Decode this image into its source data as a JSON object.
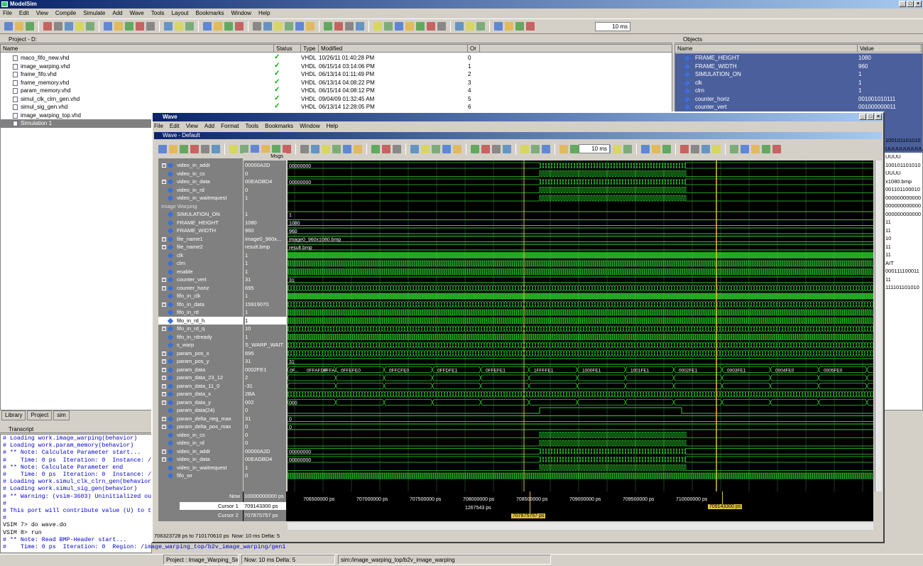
{
  "app": {
    "title": "ModelSim"
  },
  "menu": [
    "File",
    "Edit",
    "View",
    "Compile",
    "Simulate",
    "Add",
    "Wave",
    "Tools",
    "Layout",
    "Bookmarks",
    "Window",
    "Help"
  ],
  "toolbar": {
    "zoom_value": "10 ms"
  },
  "project": {
    "header": "Project - D:",
    "columns": [
      "Name",
      "Status",
      "Type",
      "Modified",
      "Order"
    ],
    "files": [
      {
        "name": "maco_fifo_new.vhd",
        "type": "VHDL",
        "modified": "10/26/11 01:40:28 PM",
        "order": "0"
      },
      {
        "name": "image_warping.vhd",
        "type": "VHDL",
        "modified": "06/15/14 03:14:06 PM",
        "order": "1"
      },
      {
        "name": "frame_fifo.vhd",
        "type": "VHDL",
        "modified": "06/13/14 01:11:49 PM",
        "order": "2"
      },
      {
        "name": "frame_memory.vhd",
        "type": "VHDL",
        "modified": "06/13/14 04:08:22 PM",
        "order": "3"
      },
      {
        "name": "param_memory.vhd",
        "type": "VHDL",
        "modified": "06/15/14 04:08:12 PM",
        "order": "4"
      },
      {
        "name": "simul_clk_clrn_gen.vhd",
        "type": "VHDL",
        "modified": "09/04/09 01:32:45 AM",
        "order": "5"
      },
      {
        "name": "simul_sig_gen.vhd",
        "type": "VHDL",
        "modified": "06/13/14 12:28:05 PM",
        "order": "6"
      },
      {
        "name": "image_warping_top.vhd",
        "type": "",
        "modified": "",
        "order": ""
      },
      {
        "name": "Simulation 1",
        "type": "",
        "modified": "",
        "order": ""
      }
    ]
  },
  "objects": {
    "header": "Objects",
    "columns": [
      "Name",
      "Value"
    ],
    "rows": [
      {
        "name": "FRAME_HEIGHT",
        "value": "1080"
      },
      {
        "name": "FRAME_WIDTH",
        "value": "960"
      },
      {
        "name": "SIMULATION_ON",
        "value": "1"
      },
      {
        "name": "clk",
        "value": "1"
      },
      {
        "name": "clrn",
        "value": "1"
      },
      {
        "name": "counter_horiz",
        "value": "001001010111"
      },
      {
        "name": "counter_vert",
        "value": "001000000011"
      }
    ],
    "right_values": [
      "100101101010",
      "UUUUUUUUUUUU",
      "UUUU",
      "100101101010",
      "UUUU",
      "x1080.bmp",
      "001101100010",
      "000000000000",
      "000000000000",
      "000000000000",
      "11",
      "11",
      "10",
      "11",
      "11",
      "AIT",
      "000111100011",
      "11",
      "111101101010"
    ]
  },
  "bottom_tabs": [
    "Library",
    "Project",
    "sim"
  ],
  "transcript": {
    "header": "Transcript",
    "lines": [
      {
        "t": "# Loading work.image_warping(behavior)",
        "c": "b"
      },
      {
        "t": "# Loading work.param_memory(behavior)",
        "c": "b"
      },
      {
        "t": "# ** Note: Calculate Parameter start...",
        "c": "b"
      },
      {
        "t": "#    Time: 0 ps  Iteration: 0  Instance: /i",
        "c": "b"
      },
      {
        "t": "# ** Note: Calculate Parameter end",
        "c": "b"
      },
      {
        "t": "#    Time: 0 ps  Iteration: 0  Instance: /i",
        "c": "b"
      },
      {
        "t": "# Loading work.simul_clk_clrn_gen(behavior)",
        "c": "b"
      },
      {
        "t": "# Loading work.simul_sig_gen(behavior)",
        "c": "b"
      },
      {
        "t": "# ** Warning: (vsim-3603) Uninitialized out",
        "c": "b"
      },
      {
        "t": "#",
        "c": "b"
      },
      {
        "t": "# This port will contribute value (U) to the",
        "c": "b"
      },
      {
        "t": "#",
        "c": "b"
      },
      {
        "t": "VSIM 7> do wave.do",
        "c": "k"
      },
      {
        "t": "VSIM 8> run",
        "c": "k"
      },
      {
        "t": "# ** Note: Read BMP-Header start...",
        "c": "b"
      },
      {
        "t": "#    Time: 0 ps  Iteration: 0  Region: /image_warping_top/b2v_image_warping/gen1",
        "c": "b"
      }
    ]
  },
  "status": {
    "project": "Project : Image_Warping_Simul",
    "now": "Now: 10 ms  Delta: 5",
    "path": "sim:/image_warping_top/b2v_image_warping"
  },
  "wave": {
    "title": "Wave",
    "subtitle": "Wave - Default",
    "menu": [
      "File",
      "Edit",
      "View",
      "Add",
      "Format",
      "Tools",
      "Bookmarks",
      "Window",
      "Help"
    ],
    "zoom": "10 ms",
    "msgs_label": "Msgs",
    "signals": [
      {
        "name": "video_in_addr",
        "value": "00000A2D",
        "plus": true
      },
      {
        "name": "video_in_cs",
        "value": "0"
      },
      {
        "name": "video_in_data",
        "value": "00EADBD4",
        "plus": true
      },
      {
        "name": "video_in_rd",
        "value": "0"
      },
      {
        "name": "video_in_waitrequest",
        "value": "1"
      },
      {
        "name": "Image Warping",
        "value": "",
        "divider": true
      },
      {
        "name": "SIMULATION_ON",
        "value": "1"
      },
      {
        "name": "FRAME_HEIGHT",
        "value": "1080"
      },
      {
        "name": "FRAME_WIDTH",
        "value": "960"
      },
      {
        "name": "file_name1",
        "value": "image0_960x...",
        "plus": true
      },
      {
        "name": "file_name2",
        "value": "result.bmp",
        "plus": true
      },
      {
        "name": "clk",
        "value": "1"
      },
      {
        "name": "clrn",
        "value": "1"
      },
      {
        "name": "enable",
        "value": "1"
      },
      {
        "name": "counter_vert",
        "value": "31",
        "plus": true
      },
      {
        "name": "counter_horiz",
        "value": "695",
        "plus": true
      },
      {
        "name": "fifo_in_clk",
        "value": "1"
      },
      {
        "name": "fifo_in_data",
        "value": "15919070",
        "plus": true
      },
      {
        "name": "fifo_in_rd",
        "value": "1"
      },
      {
        "name": "fifo_in_rd_h",
        "value": "1",
        "selected": true
      },
      {
        "name": "fifo_in_rd_q",
        "value": "10",
        "plus": true
      },
      {
        "name": "fifo_in_rdready",
        "value": "1"
      },
      {
        "name": "s_warp",
        "value": "S_WARP_WAIT"
      },
      {
        "name": "param_pos_x",
        "value": "695",
        "plus": true
      },
      {
        "name": "param_pos_y",
        "value": "31",
        "plus": true
      },
      {
        "name": "param_data",
        "value": "0002FE1",
        "plus": true
      },
      {
        "name": "param_data_23_12",
        "value": "2",
        "plus": true
      },
      {
        "name": "param_data_11_0",
        "value": "-31",
        "plus": true
      },
      {
        "name": "param_data_x",
        "value": "2BA",
        "plus": true
      },
      {
        "name": "param_data_y",
        "value": "002",
        "plus": true
      },
      {
        "name": "param_data(24)",
        "value": "0"
      },
      {
        "name": "param_delta_neg_max",
        "value": "31",
        "plus": true
      },
      {
        "name": "param_delta_pos_max",
        "value": "0",
        "plus": true
      },
      {
        "name": "video_in_cs",
        "value": "0"
      },
      {
        "name": "video_in_rd",
        "value": "0"
      },
      {
        "name": "video_in_addr",
        "value": "00000A2D",
        "plus": true
      },
      {
        "name": "video_in_data",
        "value": "00EADBD4",
        "plus": true
      },
      {
        "name": "video_in_waitrequest",
        "value": "1"
      },
      {
        "name": "fifo_wr",
        "value": "0"
      }
    ],
    "wave_labels": [
      {
        "row": 0,
        "text": "00000000"
      },
      {
        "row": 2,
        "text": "00000000"
      },
      {
        "row": 6,
        "text": "1"
      },
      {
        "row": 7,
        "text": "1080"
      },
      {
        "row": 8,
        "text": "960"
      },
      {
        "row": 9,
        "text": "image0_960x1080.bmp"
      },
      {
        "row": 10,
        "text": "result.bmp"
      },
      {
        "row": 14,
        "text": "31"
      },
      {
        "row": 24,
        "text": "31"
      },
      {
        "row": 29,
        "text": "000"
      },
      {
        "row": 31,
        "text": "0"
      },
      {
        "row": 32,
        "text": "0"
      },
      {
        "row": 35,
        "text": "00000000"
      },
      {
        "row": 36,
        "text": "00000000"
      }
    ],
    "param_data_labels": [
      "0F...",
      "0FFAFDF",
      "0FFA...",
      "0FFEFE0",
      "0FFCFE0",
      "0FFDFE1",
      "0FFEFE1",
      "1FFFFE1",
      "1000FE1",
      "1001FE1",
      "0002FE1",
      "0003FE1",
      "0004FE0",
      "0005FE0"
    ],
    "now": {
      "label": "Now",
      "value": "10000000000 ps"
    },
    "cursor1": {
      "label": "Cursor 1",
      "value": "709143300 ps"
    },
    "cursor2": {
      "label": "Cursor 2",
      "value": "707875757 ps"
    },
    "timeline": [
      "706500000 ps",
      "707000000 ps",
      "707500000 ps",
      "708000000 ps",
      "708500000 ps",
      "709000000 ps",
      "709500000 ps",
      "710000000 ps"
    ],
    "delta_label": "1267543 ps",
    "c1_flag": "709143300 ps",
    "c2_flag": "707875757 ps",
    "range_status": "706323728 ps to 710170610 ps",
    "now_status": "Now: 10 ms  Delta: 5"
  }
}
